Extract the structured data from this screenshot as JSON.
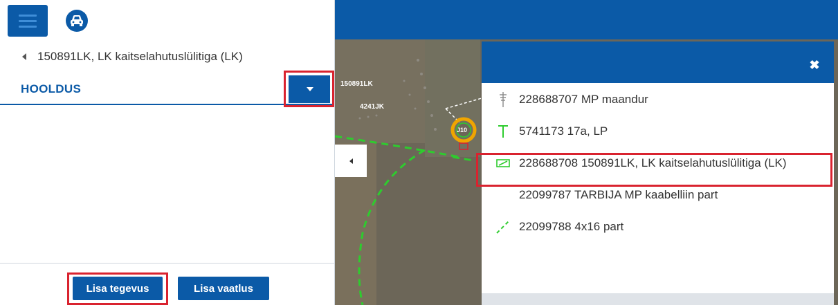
{
  "app": {
    "back_title": "150891LK, LK kaitselahutuslülitiga (LK)",
    "section_title": "HOOLDUS"
  },
  "footer": {
    "lisa_tegevus": "Lisa tegevus",
    "lisa_vaatlus": "Lisa vaatlus"
  },
  "map": {
    "labels": [
      "150891LK",
      "4241JK",
      "J10"
    ]
  },
  "popup": {
    "close_glyph": "✖",
    "items": [
      {
        "label": "228688707 MP maandur",
        "icon": "grounding-icon"
      },
      {
        "label": "5741173 17a, LP",
        "icon": "pole-icon"
      },
      {
        "label": "228688708 150891LK, LK kaitselahutuslülitiga (LK)",
        "icon": "switch-icon"
      },
      {
        "label": "22099787 TARBIJA MP kaabelliin part",
        "icon": "none"
      },
      {
        "label": "22099788 4x16 part",
        "icon": "cable-line-icon"
      }
    ]
  },
  "colors": {
    "primary": "#0b5aa7",
    "highlight": "#d9232f",
    "feature_green": "#2ecc2e",
    "selection_ring": "#f0a500"
  }
}
